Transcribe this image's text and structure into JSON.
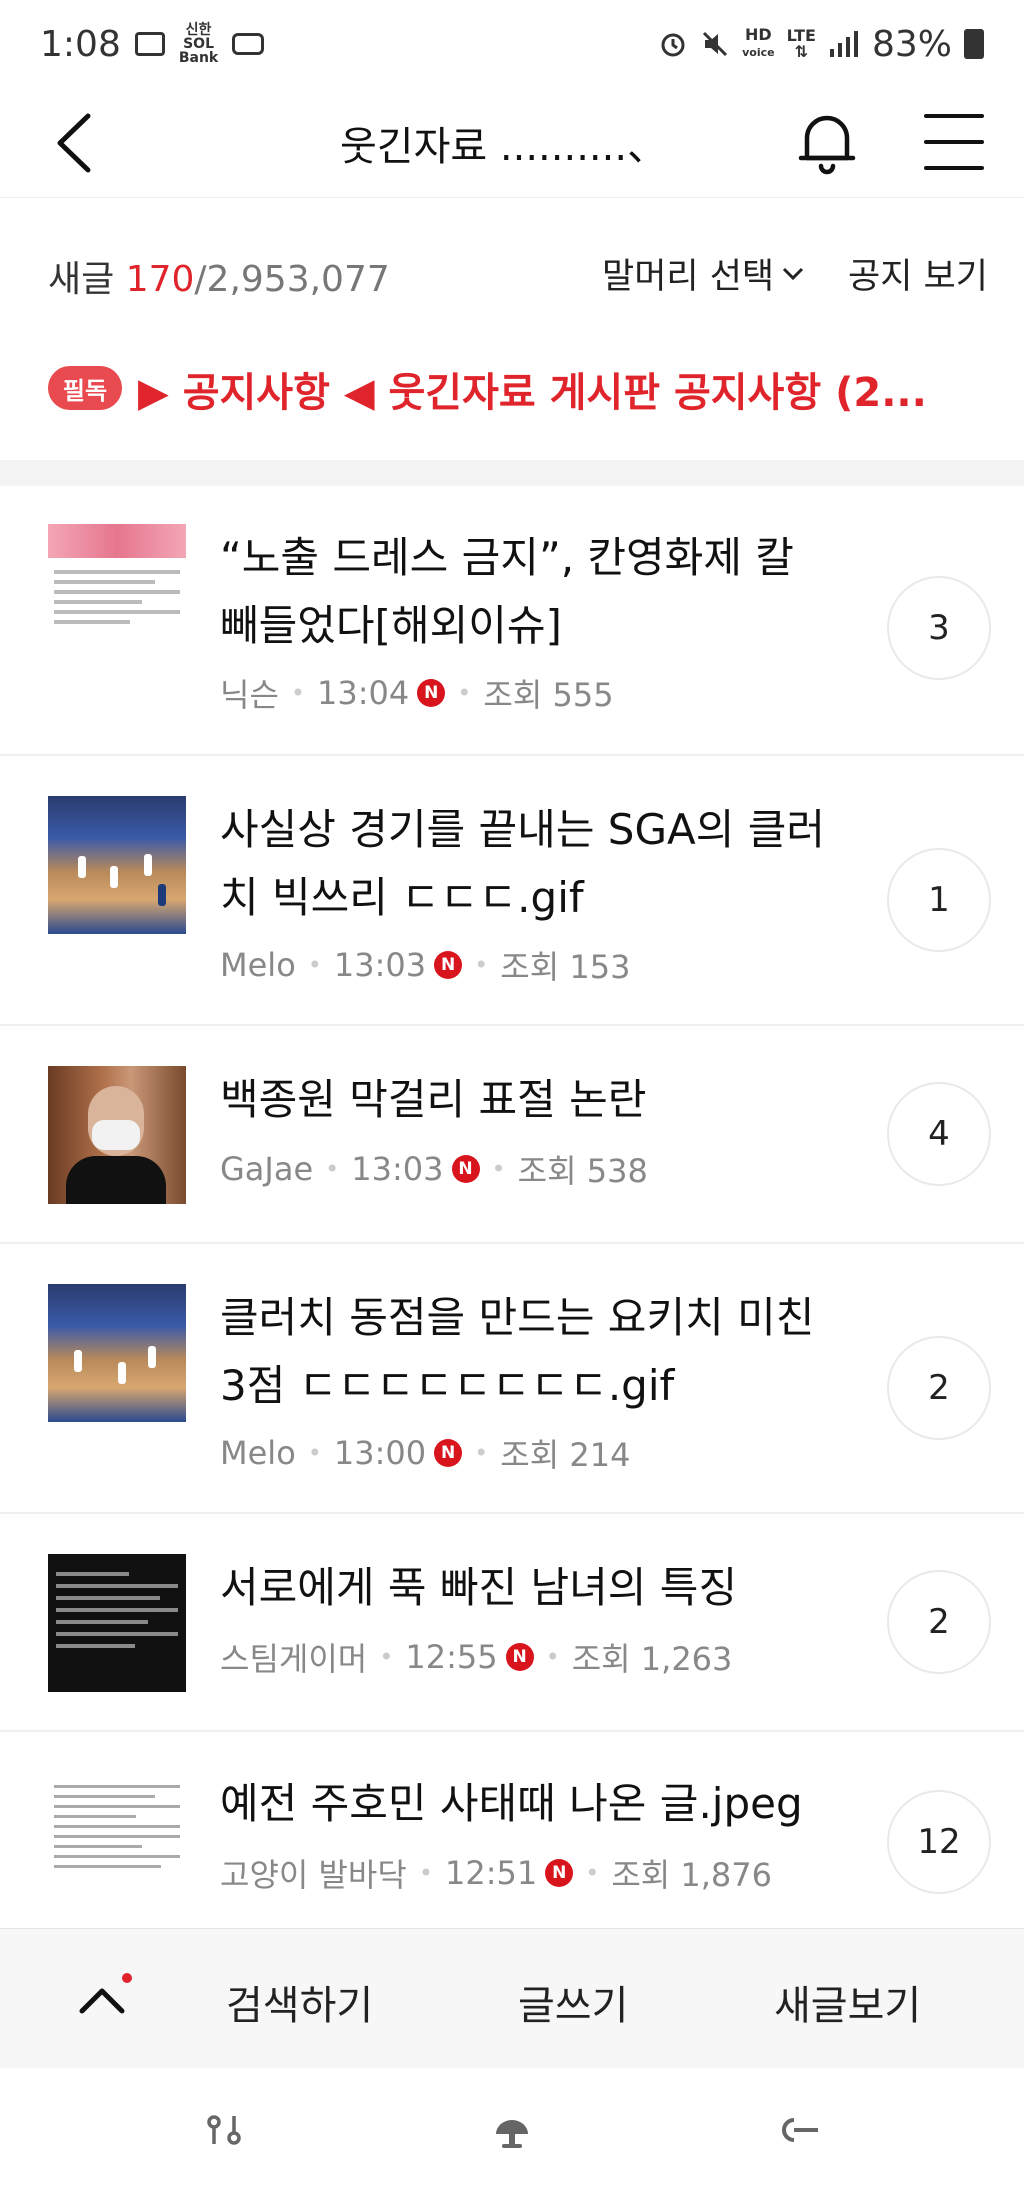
{
  "status_bar": {
    "time": "1:08",
    "bank_icon_label_top": "신한",
    "bank_icon_label": "SOL",
    "bank_icon_label_bottom": "Bank",
    "hd_label": "HD",
    "voice_label": "voice",
    "lte_label": "LTE",
    "battery": "83%"
  },
  "header": {
    "title": "웃긴자료 ..........、"
  },
  "count_bar": {
    "new_label": "새글 ",
    "new_count": "170",
    "total": "/2,953,077",
    "prefix_select": "말머리 선택",
    "notice_view": "공지 보기"
  },
  "notice": {
    "badge": "필독",
    "text": "▶ 공지사항 ◀ 웃긴자료 게시판 공지사항 (2..."
  },
  "posts": [
    {
      "title": "“노출 드레스 금지”, 칸영화제 칼 빼들었다[해외이슈]",
      "author": "닉슨",
      "time": "13:04",
      "new": "N",
      "views": "조회 555",
      "comments": "3"
    },
    {
      "title": "사실상 경기를 끝내는 SGA의 클러치 빅쓰리 ㄷㄷㄷ.gif",
      "author": "Melo",
      "time": "13:03",
      "new": "N",
      "views": "조회 153",
      "comments": "1"
    },
    {
      "title": "백종원 막걸리 표절 논란",
      "author": "GaJae",
      "time": "13:03",
      "new": "N",
      "views": "조회 538",
      "comments": "4"
    },
    {
      "title": "클러치 동점을 만드는 요키치 미친 3점 ㄷㄷㄷㄷㄷㄷㄷㄷ.gif",
      "author": "Melo",
      "time": "13:00",
      "new": "N",
      "views": "조회 214",
      "comments": "2"
    },
    {
      "title": "서로에게 푹 빠진 남녀의 특징",
      "author": "스팀게이머",
      "time": "12:55",
      "new": "N",
      "views": "조회 1,263",
      "comments": "2"
    },
    {
      "title": "예전 주호민 사태때 나온 글.jpeg",
      "author": "고양이 발바닥",
      "time": "12:51",
      "new": "N",
      "views": "조회 1,876",
      "comments": "12"
    }
  ],
  "toolbar": {
    "search": "검색하기",
    "write": "글쓰기",
    "new_posts": "새글보기"
  },
  "colors": {
    "accent": "#e0242b",
    "badge": "#e84a4f",
    "new_badge": "#d8141c"
  }
}
